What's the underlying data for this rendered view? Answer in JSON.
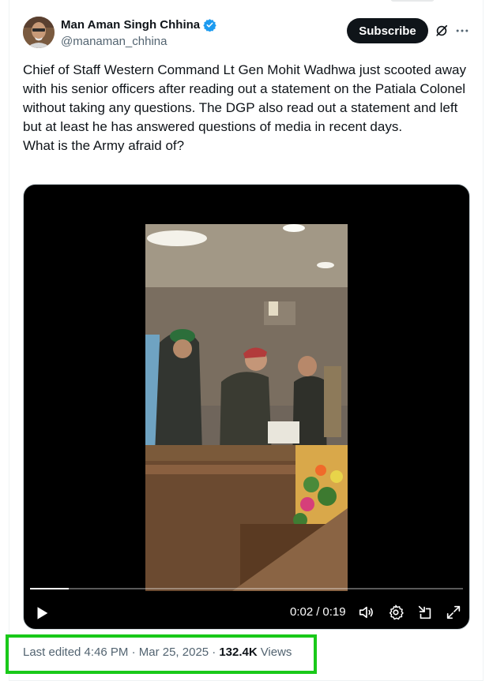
{
  "author": {
    "display_name": "Man Aman Singh Chhina",
    "handle": "@manaman_chhina",
    "verified_icon": "verified-badge-icon",
    "verified_color": "#1d9bf0"
  },
  "header_actions": {
    "subscribe_label": "Subscribe",
    "grok_icon": "grok-icon",
    "more_icon": "more-dots-icon"
  },
  "tweet": {
    "text": "Chief of Staff Western Command Lt Gen Mohit Wadhwa just scooted away with his senior officers after reading out a statement on the Patiala Colonel without taking any questions. The DGP also read out a statement and left but at least he has answered questions of media in recent days.\nWhat is the Army afraid of?"
  },
  "video": {
    "current_time": "0:02",
    "separator": "/",
    "duration": "0:19",
    "progress_fraction": 0.09,
    "controls": [
      "play-icon",
      "volume-icon",
      "settings-icon",
      "minimize-icon",
      "fullscreen-icon"
    ]
  },
  "meta": {
    "edited_label": "Last edited 4:46 PM · Mar 25, 2025 ·",
    "views_count": "132.4K",
    "views_label": "Views",
    "highlight_color": "#19c919"
  }
}
